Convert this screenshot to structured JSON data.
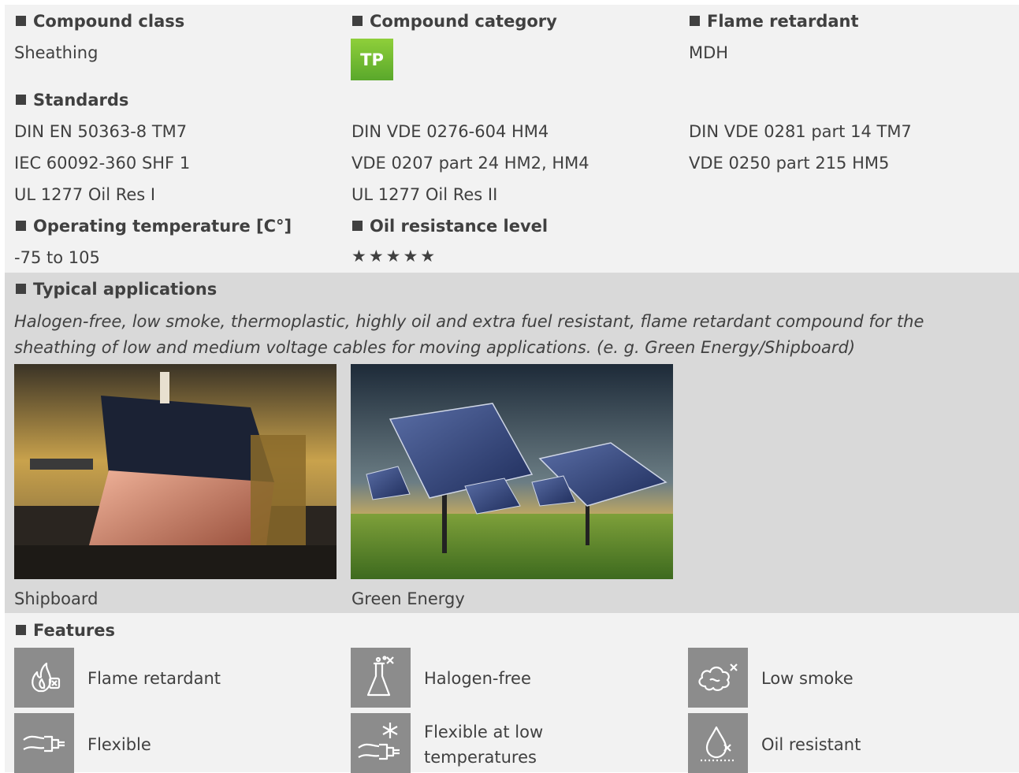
{
  "compound_class": {
    "heading": "Compound class",
    "value": "Sheathing"
  },
  "compound_category": {
    "heading": "Compound category",
    "badge": "TP",
    "badge_color": "#6ab72f"
  },
  "flame_retardant": {
    "heading": "Flame retardant",
    "value": "MDH"
  },
  "standards": {
    "heading": "Standards",
    "items": [
      "DIN EN 50363-8 TM7",
      "DIN VDE 0276-604 HM4",
      "DIN VDE 0281 part 14 TM7",
      "IEC 60092-360 SHF 1",
      "VDE 0207 part 24 HM2, HM4",
      "VDE 0250 part 215 HM5",
      "UL 1277 Oil Res I",
      "UL 1277 Oil Res II"
    ]
  },
  "operating_temperature": {
    "heading": "Operating temperature [C°]",
    "value": "-75 to 105"
  },
  "oil_resistance": {
    "heading": "Oil resistance level",
    "stars": "★★★★★"
  },
  "applications": {
    "heading": "Typical applications",
    "description_line1": "Halogen-free, low smoke, thermoplastic, highly oil and extra fuel resistant, flame retardant compound for the",
    "description_line2": "sheathing of low and medium voltage cables for moving applications. (e. g. Green Energy/Shipboard)",
    "images": [
      {
        "caption": "Shipboard",
        "icon": "ship-photo"
      },
      {
        "caption": "Green Energy",
        "icon": "solar-panels-photo"
      }
    ]
  },
  "features": {
    "heading": "Features",
    "items": [
      {
        "label": "Flame retardant",
        "icon": "flame-icon"
      },
      {
        "label": "Halogen-free",
        "icon": "flask-icon"
      },
      {
        "label": "Low smoke",
        "icon": "smoke-icon"
      },
      {
        "label": "Flexible",
        "icon": "cable-icon"
      },
      {
        "label_line1": "Flexible at low",
        "label_line2": "temperatures",
        "icon": "snowflake-cable-icon"
      },
      {
        "label": "Oil resistant",
        "icon": "oil-drop-icon"
      }
    ]
  },
  "colors": {
    "band_light": "#f2f2f2",
    "band_mid": "#d9d9d9",
    "icon_bg": "#8c8c8c",
    "text": "#404040"
  }
}
